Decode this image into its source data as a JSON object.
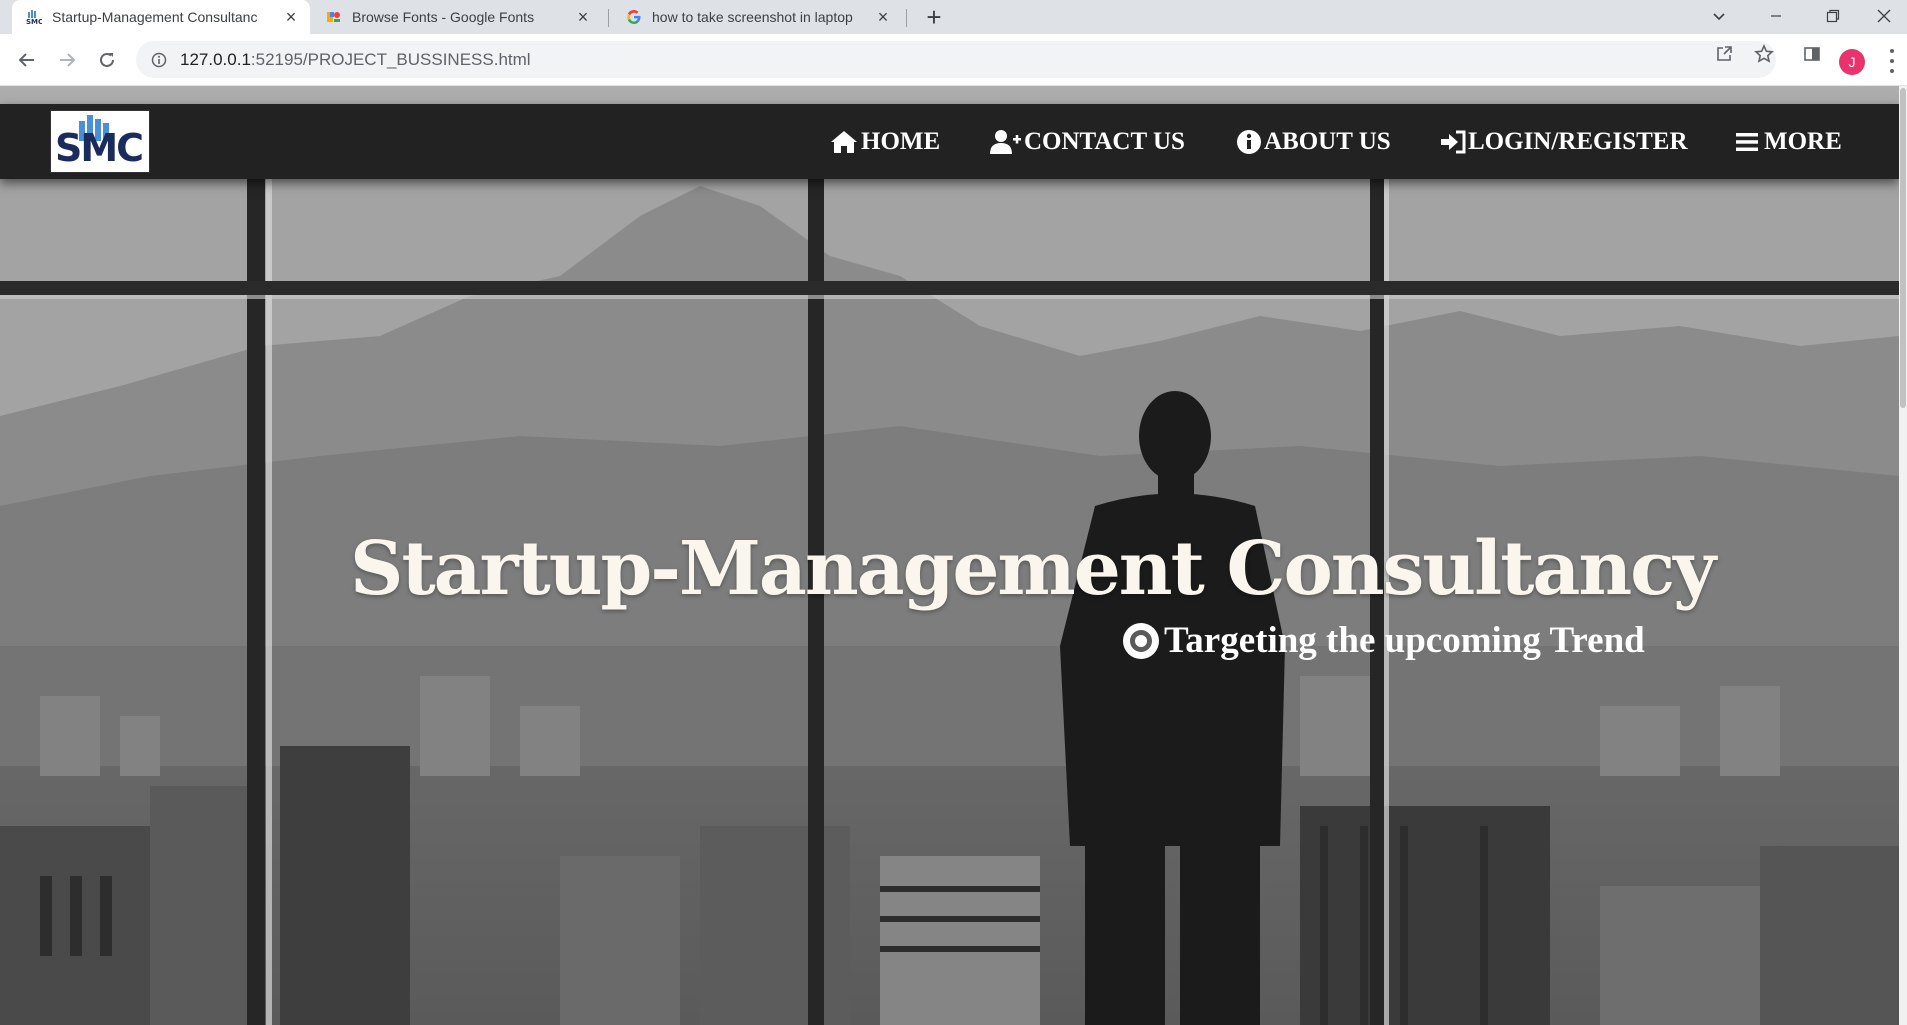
{
  "browser": {
    "tabs": [
      {
        "title": "Startup-Management Consultanc",
        "icon": "smc-favicon",
        "active": true
      },
      {
        "title": "Browse Fonts - Google Fonts",
        "icon": "google-fonts-favicon",
        "active": false
      },
      {
        "title": "how to take screenshot in laptop",
        "icon": "google-favicon",
        "active": false
      }
    ],
    "url_host": "127.0.0.1",
    "url_path": ":52195/PROJECT_BUSSINESS.html",
    "profile_initial": "J",
    "profile_color": "#e8336d"
  },
  "site": {
    "logo_text": "SMC",
    "nav": [
      {
        "label": "HOME",
        "icon": "home-icon"
      },
      {
        "label": "CONTACT US",
        "icon": "user-plus-icon"
      },
      {
        "label": "ABOUT US",
        "icon": "info-circle-icon"
      },
      {
        "label": "LOGIN/REGISTER",
        "icon": "sign-in-icon"
      },
      {
        "label": "MORE",
        "icon": "menu-bars-icon"
      }
    ],
    "hero": {
      "title": "Startup-Management Consultancy",
      "subtitle": "Targeting the upcoming Trend",
      "subtitle_icon": "dot-circle-icon"
    },
    "colors": {
      "navbar_bg": "#222222",
      "nav_text": "#ffffff",
      "hero_title": "#faf6ee"
    }
  }
}
